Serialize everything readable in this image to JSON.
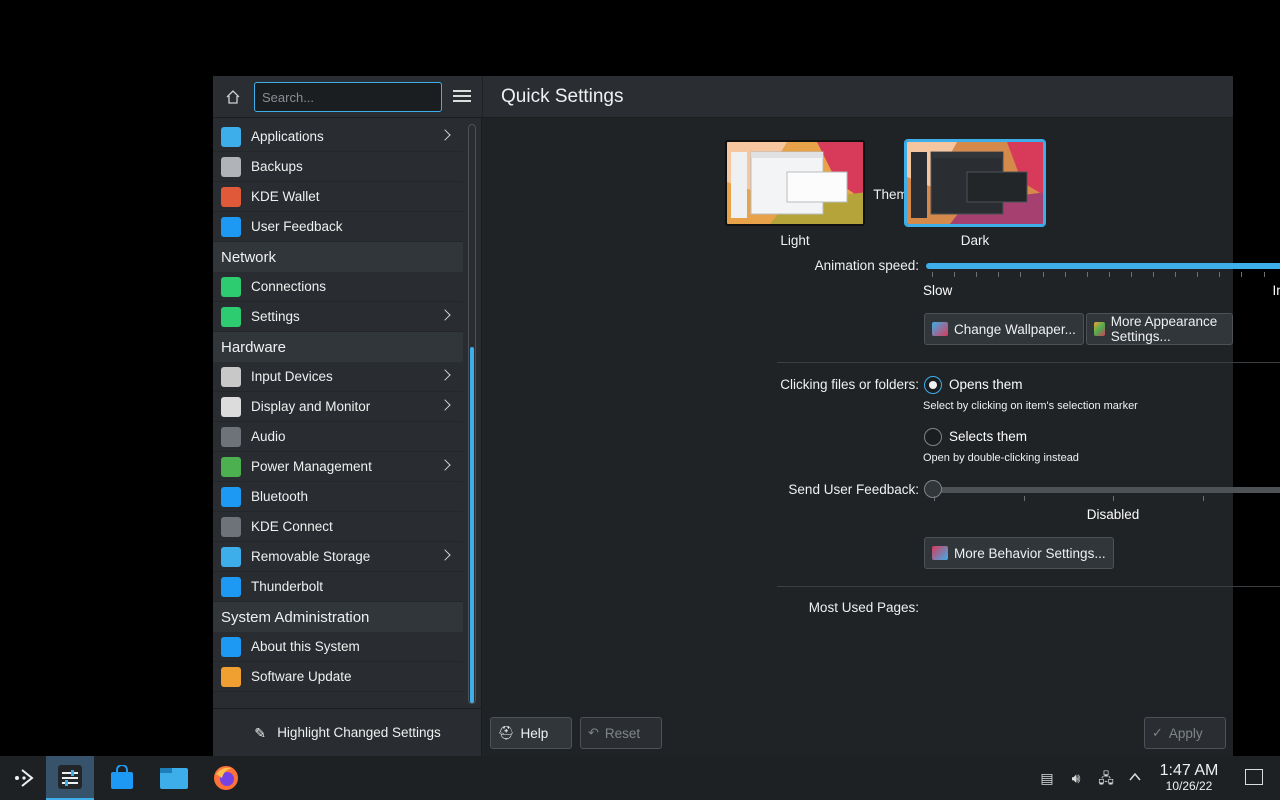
{
  "window": {
    "sidebar": {
      "search_placeholder": "Search...",
      "items_top": [
        {
          "label": "Applications",
          "icon": "applications-icon",
          "color": "#3daee9",
          "chevron": true
        },
        {
          "label": "Backups",
          "icon": "backups-icon",
          "color": "#b0b4b8",
          "chevron": false
        },
        {
          "label": "KDE Wallet",
          "icon": "kde-wallet-icon",
          "color": "#e05a3a",
          "chevron": false
        },
        {
          "label": "User Feedback",
          "icon": "user-feedback-icon",
          "color": "#1d99f3",
          "chevron": false
        }
      ],
      "network_title": "Network",
      "network_items": [
        {
          "label": "Connections",
          "icon": "connections-icon",
          "color": "#2ecc71",
          "chevron": false
        },
        {
          "label": "Settings",
          "icon": "network-settings-icon",
          "color": "#2ecc71",
          "chevron": true
        }
      ],
      "hardware_title": "Hardware",
      "hardware_items": [
        {
          "label": "Input Devices",
          "icon": "input-devices-icon",
          "color": "#c8c8c8",
          "chevron": true
        },
        {
          "label": "Display and Monitor",
          "icon": "display-icon",
          "color": "#dcdcdc",
          "chevron": true
        },
        {
          "label": "Audio",
          "icon": "audio-icon",
          "color": "#6e737a",
          "chevron": false
        },
        {
          "label": "Power Management",
          "icon": "power-management-icon",
          "color": "#4caf50",
          "chevron": true
        },
        {
          "label": "Bluetooth",
          "icon": "bluetooth-icon",
          "color": "#1d99f3",
          "chevron": false
        },
        {
          "label": "KDE Connect",
          "icon": "kde-connect-icon",
          "color": "#6e737a",
          "chevron": false
        },
        {
          "label": "Removable Storage",
          "icon": "removable-storage-icon",
          "color": "#3daee9",
          "chevron": true
        },
        {
          "label": "Thunderbolt",
          "icon": "thunderbolt-icon",
          "color": "#1d99f3",
          "chevron": false
        }
      ],
      "sysadmin_title": "System Administration",
      "sysadmin_items": [
        {
          "label": "About this System",
          "icon": "info-icon",
          "color": "#1d99f3",
          "chevron": false
        },
        {
          "label": "Software Update",
          "icon": "software-update-icon",
          "color": "#f0a030",
          "chevron": false
        }
      ],
      "footer_label": "Highlight Changed Settings"
    },
    "main": {
      "title": "Quick Settings",
      "theme_label": "Theme:",
      "theme_light": "Light",
      "theme_dark": "Dark",
      "theme_selected": "Dark",
      "animation_label": "Animation speed:",
      "animation_slow": "Slow",
      "animation_instant": "Instant",
      "animation_value": 1.0,
      "change_wallpaper": "Change Wallpaper...",
      "more_appearance": "More Appearance Settings...",
      "clicking_label": "Clicking files or folders:",
      "opens_them": "Opens them",
      "opens_hint": "Select by clicking on item's selection marker",
      "selects_them": "Selects them",
      "selects_hint": "Open by double-clicking instead",
      "clicking_selected": "Opens them",
      "feedback_label": "Send User Feedback:",
      "feedback_value": "Disabled",
      "feedback_level": 0,
      "more_behavior": "More Behavior Settings...",
      "most_used_label": "Most Used Pages:",
      "help": "Help",
      "reset": "Reset",
      "apply": "Apply"
    }
  },
  "taskbar": {
    "time": "1:47 AM",
    "date": "10/26/22"
  },
  "colors": {
    "accent": "#3daee9",
    "window_bg": "#202326",
    "sidebar_bg": "#292c30"
  }
}
